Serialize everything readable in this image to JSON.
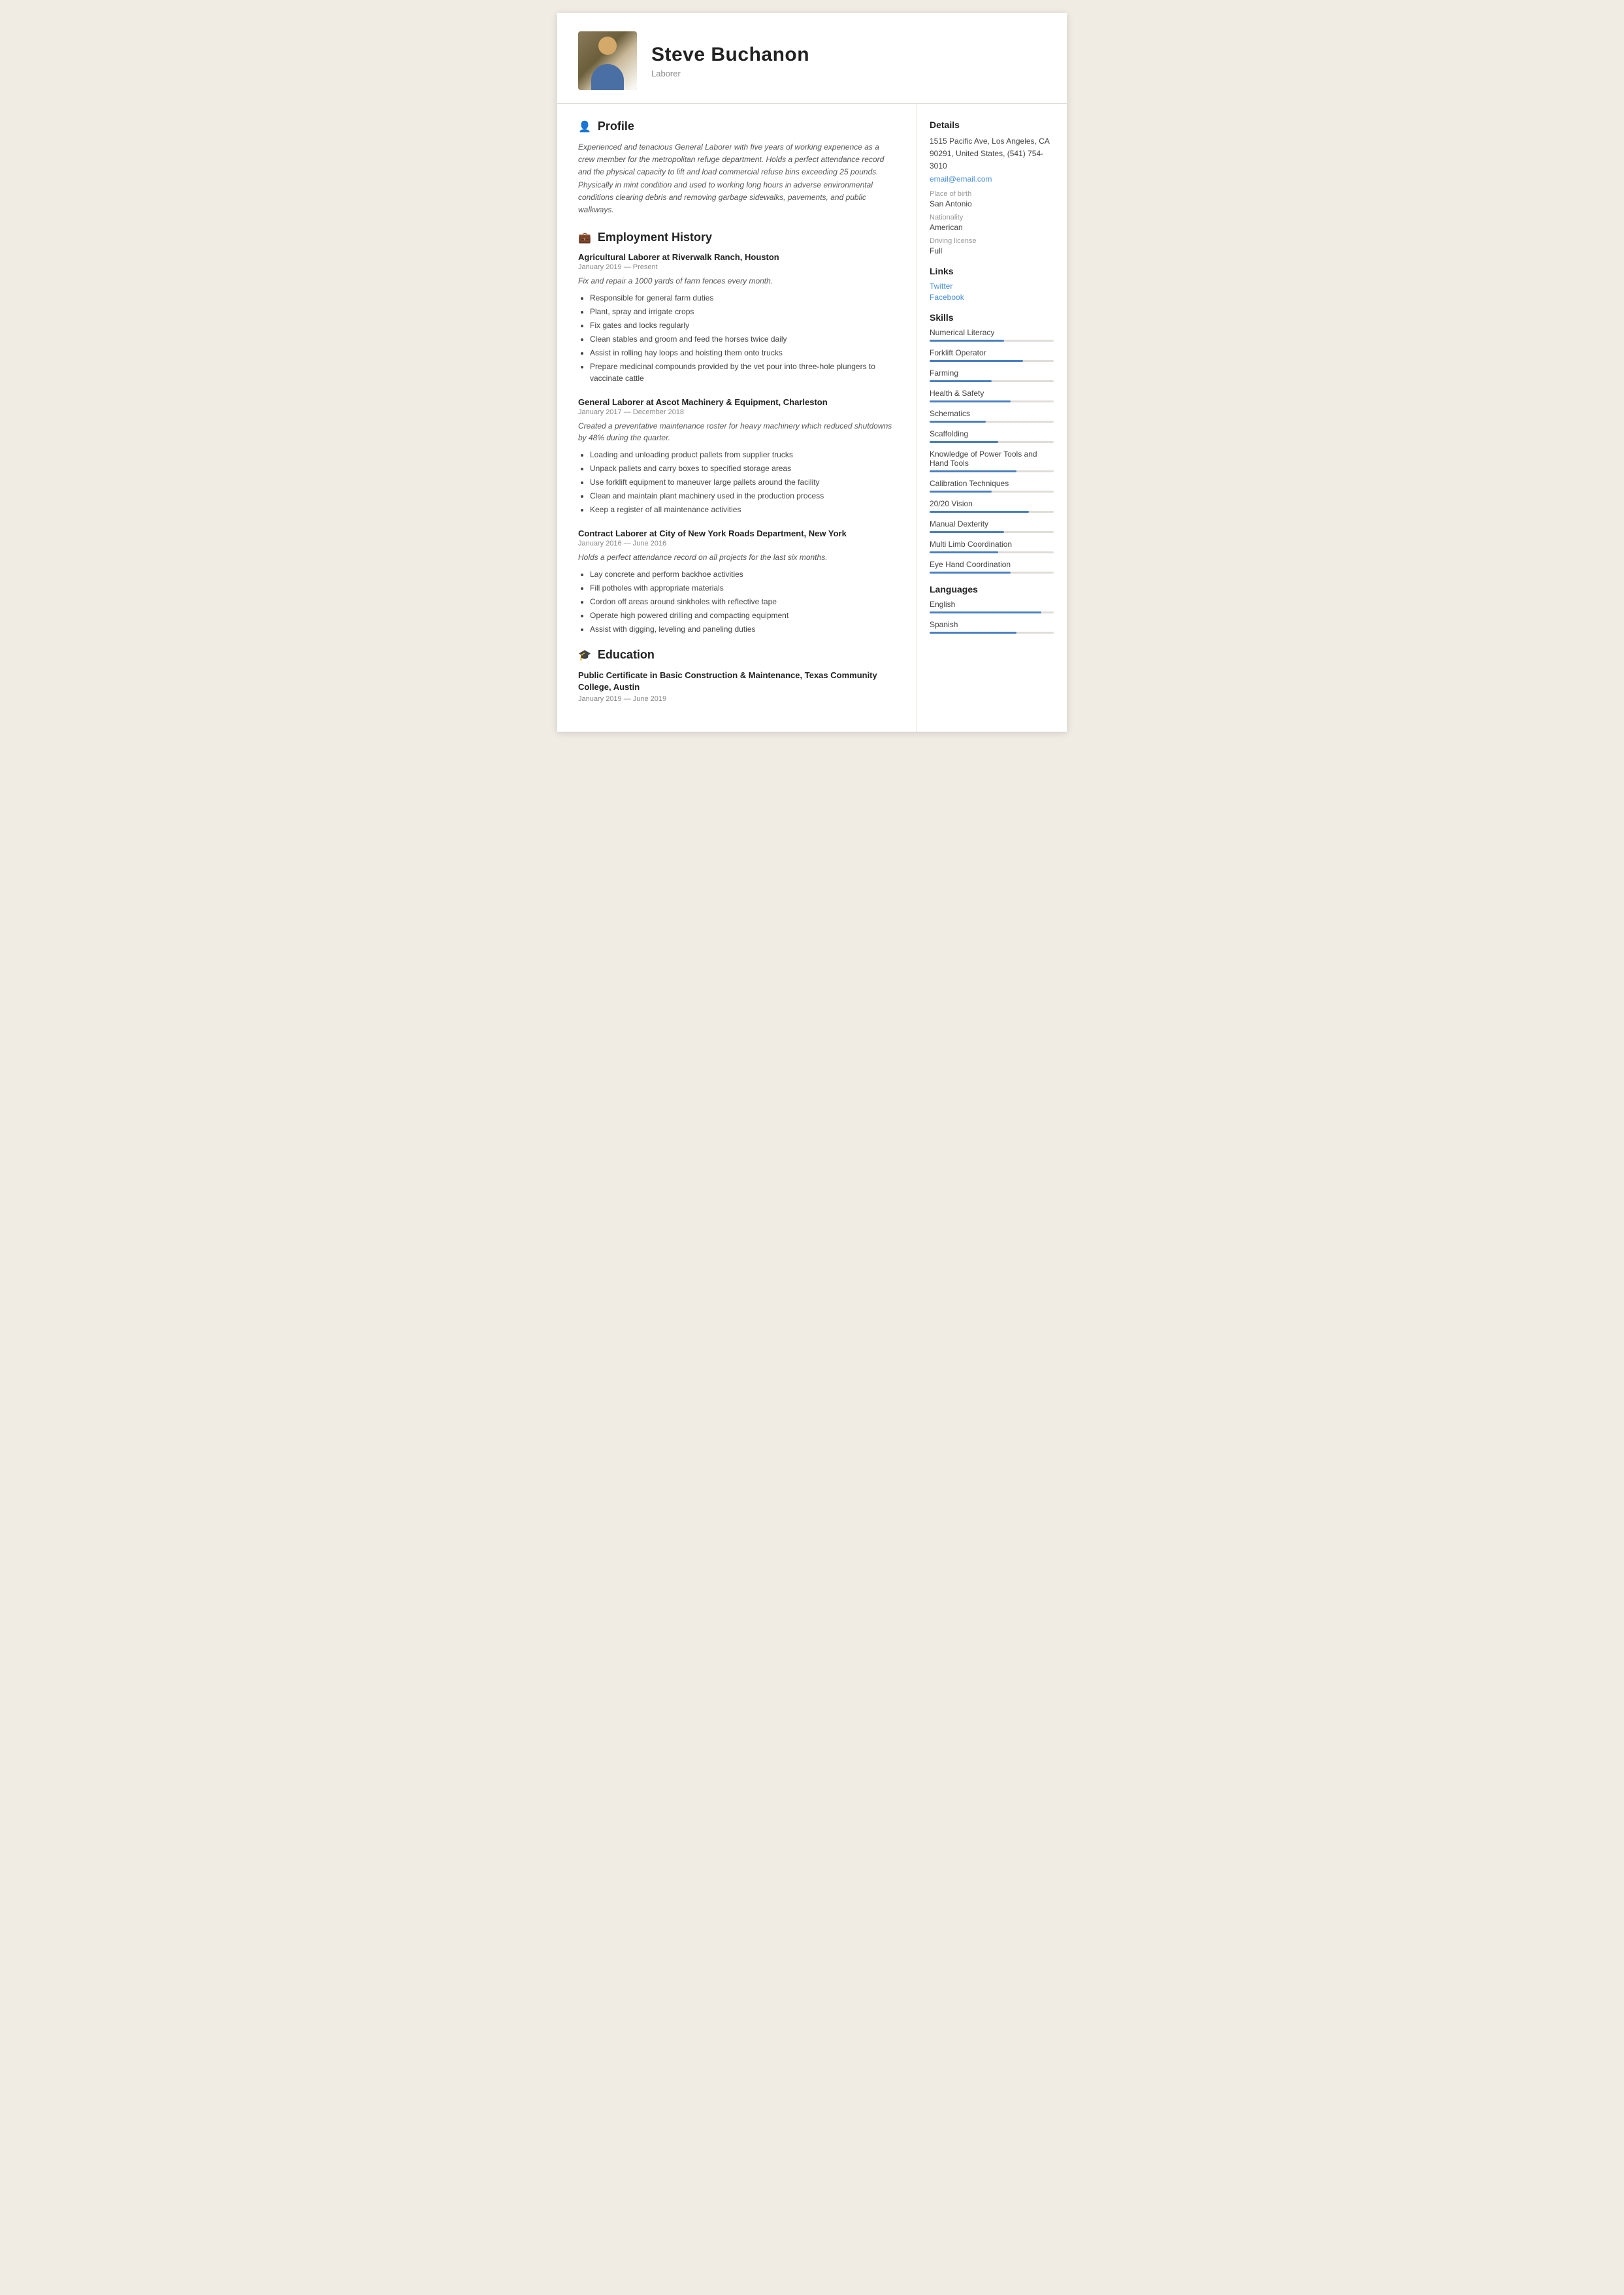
{
  "header": {
    "name": "Steve  Buchanon",
    "title": "Laborer"
  },
  "profile": {
    "section_title": "Profile",
    "text": "Experienced and tenacious General Laborer with five years of working experience as a crew member for the metropolitan refuge department. Holds a perfect attendance record and the physical capacity to lift and load commercial refuse bins exceeding 25 pounds. Physically in mint condition and used to working long hours in adverse environmental conditions clearing debris and removing garbage sidewalks, pavements, and public walkways."
  },
  "employment": {
    "section_title": "Employment History",
    "jobs": [
      {
        "title": "Agricultural Laborer at  Riverwalk Ranch, Houston",
        "dates": "January 2019 — Present",
        "summary": "Fix and repair a 1000 yards of farm fences every month.",
        "bullets": [
          "Responsible for general farm duties",
          "Plant, spray and irrigate crops",
          "Fix gates and locks regularly",
          "Clean stables and groom and feed the horses twice daily",
          "Assist in rolling hay loops and hoisting them onto trucks",
          "Prepare  medicinal compounds provided by the vet pour into three-hole plungers to     vaccinate cattle"
        ]
      },
      {
        "title": "General Laborer at  Ascot Machinery & Equipment, Charleston",
        "dates": "January 2017 — December 2018",
        "summary": "Created a preventative maintenance roster for heavy machinery which reduced shutdowns by 48% during the quarter.",
        "bullets": [
          "Loading and unloading product pallets from supplier trucks",
          "Unpack pallets  and carry boxes to specified storage areas",
          "Use forklift equipment to maneuver large pallets around the facility",
          "Clean and maintain plant machinery used in the production process",
          "Keep a register of all maintenance activities"
        ]
      },
      {
        "title": "Contract Laborer at  City of New York Roads Department, New York",
        "dates": "January 2016 — June 2016",
        "summary": "Holds a perfect attendance record on all projects for the last six months.",
        "bullets": [
          "Lay concrete and perform backhoe activities",
          "Fill potholes with appropriate materials",
          "Cordon off areas around sinkholes with reflective tape",
          "Operate high powered drilling and compacting equipment",
          "Assist with digging, leveling and paneling duties"
        ]
      }
    ]
  },
  "education": {
    "section_title": "Education",
    "items": [
      {
        "title": "Public Certificate in Basic Construction & Maintenance, Texas Community College, Austin",
        "dates": "January 2019 — June 2019"
      }
    ]
  },
  "details": {
    "section_title": "Details",
    "address": "1515 Pacific Ave, Los Angeles, CA 90291, United States, (541) 754-3010",
    "email": "email@email.com",
    "place_of_birth_label": "Place of birth",
    "place_of_birth": "San Antonio",
    "nationality_label": "Nationality",
    "nationality": "American",
    "driving_license_label": "Driving license",
    "driving_license": "Full"
  },
  "links": {
    "section_title": "Links",
    "items": [
      {
        "label": "Twitter"
      },
      {
        "label": "Facebook"
      }
    ]
  },
  "skills": {
    "section_title": "Skills",
    "items": [
      {
        "name": "Numerical Literacy",
        "level": 60
      },
      {
        "name": "Forklift Operator",
        "level": 75
      },
      {
        "name": "Farming",
        "level": 50
      },
      {
        "name": "Health & Safety",
        "level": 65
      },
      {
        "name": "Schematics",
        "level": 45
      },
      {
        "name": "Scaffolding",
        "level": 55
      },
      {
        "name": "Knowledge of Power Tools and Hand Tools",
        "level": 70
      },
      {
        "name": "Calibration Techniques",
        "level": 50
      },
      {
        "name": "20/20 Vision",
        "level": 80
      },
      {
        "name": "Manual Dexterity",
        "level": 60
      },
      {
        "name": "Multi Limb Coordination",
        "level": 55
      },
      {
        "name": "Eye Hand Coordination",
        "level": 65
      }
    ]
  },
  "languages": {
    "section_title": "Languages",
    "items": [
      {
        "name": "English",
        "level": 90
      },
      {
        "name": "Spanish",
        "level": 70
      }
    ]
  },
  "icons": {
    "profile": "👤",
    "employment": "💼",
    "education": "🎓"
  }
}
